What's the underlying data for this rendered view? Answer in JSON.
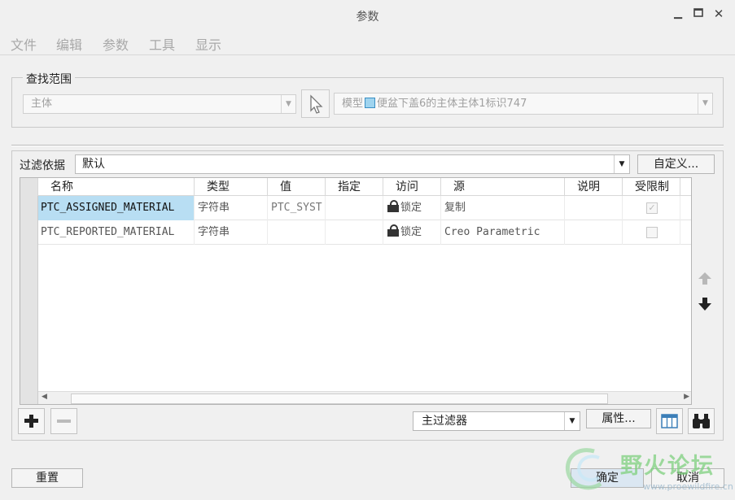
{
  "window": {
    "title": "参数"
  },
  "menu": [
    "文件",
    "编辑",
    "参数",
    "工具",
    "显示"
  ],
  "scope": {
    "legend": "查找范围",
    "level_value": "主体",
    "model_prefix": "模型",
    "model_text": "便盆下盖6的主体主体1标识747"
  },
  "filter": {
    "label": "过滤依据",
    "value": "默认",
    "customize_label": "自定义..."
  },
  "table": {
    "columns": [
      "名称",
      "类型",
      "值",
      "指定",
      "访问",
      "源",
      "说明",
      "受限制"
    ],
    "rows": [
      {
        "name": "PTC_ASSIGNED_MATERIAL",
        "type": "字符串",
        "value": "PTC_SYST",
        "designate": "",
        "access": "锁定",
        "source": "复制",
        "description": "",
        "restricted": true,
        "selected": true
      },
      {
        "name": "PTC_REPORTED_MATERIAL",
        "type": "字符串",
        "value": "",
        "designate": "",
        "access": "锁定",
        "source": "Creo Parametric",
        "description": "",
        "restricted": false,
        "selected": false
      }
    ]
  },
  "bottom": {
    "main_filter": "主过滤器",
    "properties_label": "属性..."
  },
  "footer": {
    "reset_label": "重置",
    "ok_label": "确定",
    "cancel_label": "取消"
  },
  "watermark": {
    "text": "野火论坛",
    "url": "www.proewildfire.cn"
  },
  "colors": {
    "selection": "#b8def3",
    "watermark_green": "#7fd17f",
    "lock": "#333333"
  }
}
